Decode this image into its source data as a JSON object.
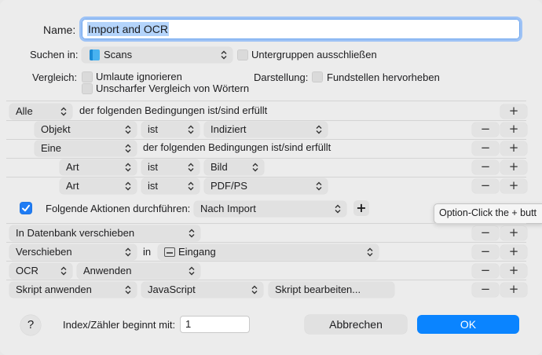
{
  "name_label": "Name:",
  "name_value": "Import and OCR",
  "search_label": "Suchen in:",
  "search_location": "Scans",
  "exclude_subgroups": "Untergruppen ausschließen",
  "compare_label": "Vergleich:",
  "ignore_umlauts": "Umlaute ignorieren",
  "fuzzy_compare": "Unscharfer Vergleich von Wörtern",
  "display_label": "Darstellung:",
  "highlight_matches": "Fundstellen hervorheben",
  "conditions": {
    "root_mode": "Alle",
    "root_text": "der folgenden Bedingungen ist/sind erfüllt",
    "row1": {
      "field": "Objekt",
      "op": "ist",
      "value": "Indiziert"
    },
    "row2": {
      "mode": "Eine",
      "text": "der folgenden Bedingungen ist/sind erfüllt"
    },
    "row3": {
      "field": "Art",
      "op": "ist",
      "value": "Bild"
    },
    "row4": {
      "field": "Art",
      "op": "ist",
      "value": "PDF/PS"
    }
  },
  "actions": {
    "toggle_label": "Folgende Aktionen durchführen:",
    "trigger": "Nach Import",
    "tooltip": "Option-Click the + butt",
    "row1": {
      "action": "In Datenbank verschieben"
    },
    "row2": {
      "action": "Verschieben",
      "in": "in",
      "destination": "Eingang"
    },
    "row3": {
      "action": "OCR",
      "mode": "Anwenden"
    },
    "row4": {
      "action": "Skript anwenden",
      "language": "JavaScript",
      "edit": "Skript bearbeiten..."
    }
  },
  "plus": "+",
  "minus": "−",
  "help": "?",
  "index_label": "Index/Zähler beginnt mit:",
  "index_value": "1",
  "cancel": "Abbrechen",
  "ok": "OK",
  "colors": {
    "accent": "#1f7cf4",
    "ok_button": "#0a84ff"
  }
}
